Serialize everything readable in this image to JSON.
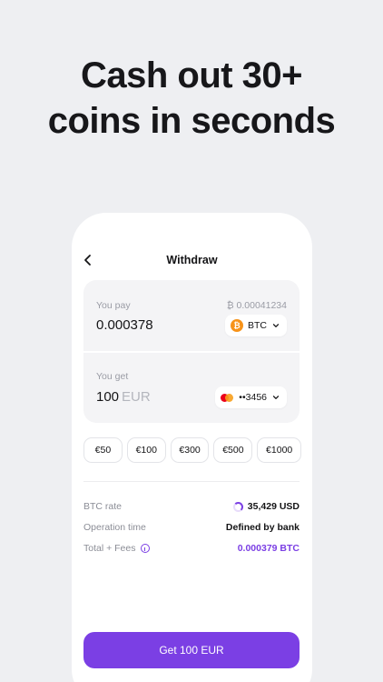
{
  "headline": {
    "line1": "Cash out 30+",
    "line2": "coins in seconds"
  },
  "screen": {
    "title": "Withdraw",
    "back_icon": "chevron-left-icon",
    "pay": {
      "label": "You pay",
      "balance": "₿ 0.00041234",
      "amount": "0.000378",
      "currency": "BTC",
      "currency_icon": "bitcoin-icon"
    },
    "get": {
      "label": "You get",
      "amount": "100",
      "currency_suffix": "EUR",
      "card": "••3456",
      "card_icon": "mastercard-icon"
    },
    "quick_amounts": [
      "€50",
      "€100",
      "€300",
      "€500",
      "€1000"
    ],
    "details": [
      {
        "label": "BTC rate",
        "value": "35,429 USD"
      },
      {
        "label": "Operation time",
        "value": "Defined by bank"
      },
      {
        "label": "Total + Fees",
        "value": "0.000379 BTC"
      }
    ],
    "cta": "Get 100 EUR"
  },
  "colors": {
    "accent": "#7b3fe4",
    "bitcoin": "#f7931a",
    "background": "#eeeff2"
  }
}
